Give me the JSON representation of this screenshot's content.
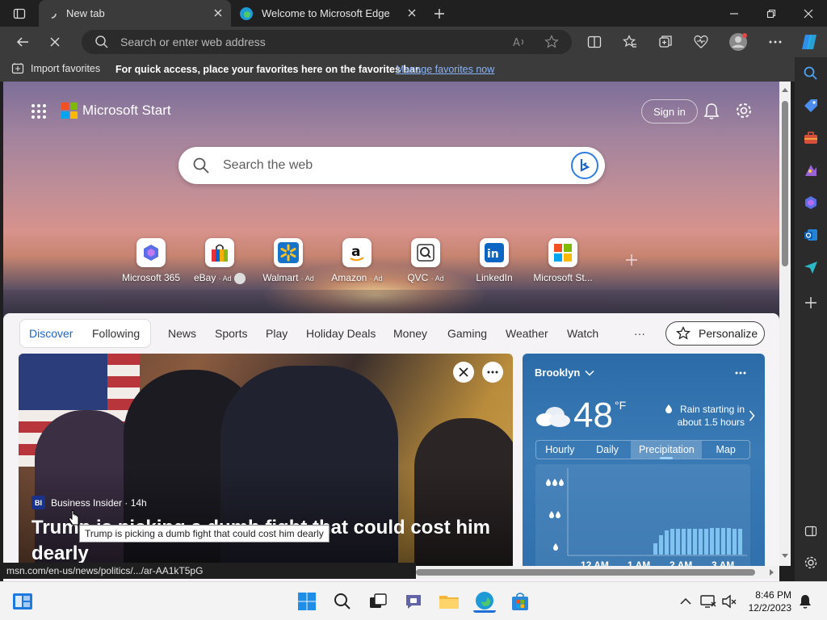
{
  "tabs": [
    {
      "label": "New tab",
      "active": true
    },
    {
      "label": "Welcome to Microsoft Edge",
      "active": false
    }
  ],
  "address": {
    "placeholder": "Search or enter web address"
  },
  "favorites_bar": {
    "import_label": "Import favorites",
    "message": "For quick access, place your favorites here on the favorites bar.",
    "manage_link": "Manage favorites now"
  },
  "start": {
    "brand": "Microsoft Start",
    "sign_in": "Sign in",
    "search_placeholder": "Search the web"
  },
  "quick_links": [
    {
      "label": "Microsoft 365",
      "ad": ""
    },
    {
      "label": "eBay",
      "ad": "· Ad"
    },
    {
      "label": "Walmart",
      "ad": "· Ad"
    },
    {
      "label": "Amazon",
      "ad": "· Ad"
    },
    {
      "label": "QVC",
      "ad": "· Ad"
    },
    {
      "label": "LinkedIn",
      "ad": ""
    },
    {
      "label": "Microsoft St...",
      "ad": ""
    }
  ],
  "feed_nav": {
    "items": [
      "Discover",
      "Following",
      "News",
      "Sports",
      "Play",
      "Holiday Deals",
      "Money",
      "Gaming",
      "Weather",
      "Watch"
    ],
    "more": "···",
    "personalize": "Personalize"
  },
  "news_card": {
    "source": "Business Insider · 14h",
    "source_badge": "BI",
    "headline": "Trump is picking a dumb fight that could cost him dearly",
    "tooltip": "Trump is picking a dumb fight that could cost him dearly"
  },
  "weather": {
    "location": "Brooklyn",
    "temperature": "48",
    "unit": "°F",
    "forecast": "Rain starting in about 1.5 hours",
    "tabs": [
      "Hourly",
      "Daily",
      "Precipitation",
      "Map"
    ],
    "selected_tab": "Precipitation",
    "chart_times": [
      "12 AM",
      "1 AM",
      "2 AM",
      "3 AM"
    ]
  },
  "status_url": "msn.com/en-us/news/politics/.../ar-AA1kT5pG",
  "clock": {
    "time": "8:46 PM",
    "date": "12/2/2023"
  },
  "colors": {
    "accent": "#1a64c8",
    "link": "#8ab4f8",
    "weather_bg": "#2f70ad",
    "precip_bars": "#7fc3f0"
  }
}
